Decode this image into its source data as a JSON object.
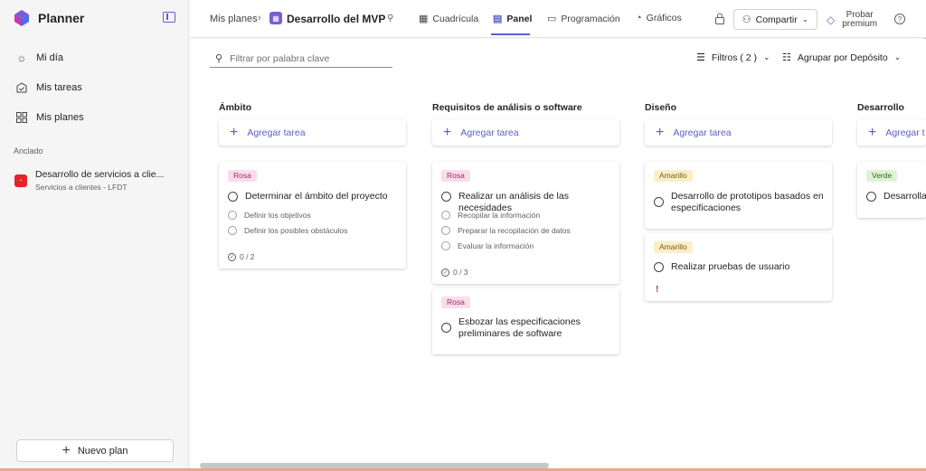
{
  "app": {
    "name": "Planner"
  },
  "sidebar": {
    "nav": [
      {
        "label": "Mi día",
        "icon": "sun-icon"
      },
      {
        "label": "Mis tareas",
        "icon": "tasks-icon"
      },
      {
        "label": "Mis planes",
        "icon": "grid-icon"
      }
    ],
    "pinned_label": "Anclado",
    "pinned": {
      "title": "Desarrollo de servicios a clie...",
      "subtitle": "Servicios a clientes - LFDT"
    },
    "new_plan_label": "Nuevo plan"
  },
  "header": {
    "breadcrumb_root": "Mis planes",
    "plan_title": "Desarrollo del MVP",
    "tabs": [
      {
        "label": "Cuadrícula",
        "active": false
      },
      {
        "label": "Panel",
        "active": true
      },
      {
        "label": "Programación",
        "active": false
      },
      {
        "label": "Gráficos",
        "active": false
      }
    ],
    "share_label": "Compartir",
    "premium_line1": "Probar",
    "premium_line2": "premium"
  },
  "toolbar": {
    "filter_placeholder": "Filtrar por palabra clave",
    "filters_label": "Filtros ( 2 )",
    "group_label": "Agrupar por Depósito"
  },
  "board": {
    "add_task_label": "Agregar tarea",
    "columns": [
      {
        "title": "Ámbito",
        "cards": [
          {
            "label": "Rosa",
            "title": "Determinar el ámbito del proyecto",
            "subtasks": [
              "Definir los objetivos",
              "Definir los posibles obstáculos"
            ],
            "progress": "0 / 2"
          }
        ]
      },
      {
        "title": "Requisitos de análisis o software",
        "cards": [
          {
            "label": "Rosa",
            "title": "Realizar un análisis de las necesidades",
            "subtasks": [
              "Recopilar la información",
              "Preparar la recopilación de datos",
              "Evaluar la información"
            ],
            "progress": "0 / 3"
          },
          {
            "label": "Rosa",
            "title": "Esbozar las especificaciones preliminares de software"
          }
        ]
      },
      {
        "title": "Diseño",
        "cards": [
          {
            "label": "Amarillo",
            "title": "Desarrollo de prototipos basados en especificaciones"
          },
          {
            "label": "Amarillo",
            "title": "Realizar pruebas de usuario",
            "priority": "!"
          }
        ]
      },
      {
        "title": "Desarrollo",
        "add_task_visible": "Agregar t",
        "cards": [
          {
            "label": "Verde",
            "title": "Desarrolla"
          }
        ]
      }
    ]
  },
  "colors": {
    "accent": "#5b5fc7",
    "label_rosa": "#fbdcec",
    "label_amarillo": "#fbefc9",
    "label_verde": "#dff3d4",
    "priority": "#c4314b"
  }
}
